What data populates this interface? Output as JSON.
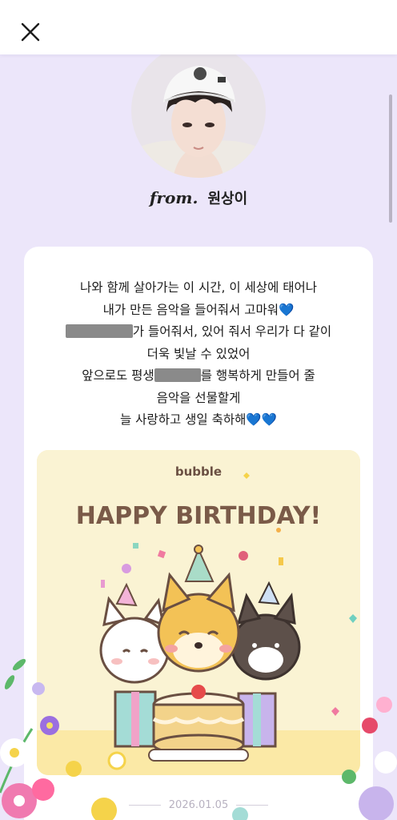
{
  "header": {
    "close_icon": "close-icon"
  },
  "sender": {
    "from_label": "from.",
    "name": "원상이"
  },
  "message": {
    "line1": "나와 함께 살아가는 이 시간, 이 세상에 태어나",
    "line2": "내가 만든 음악을 들어줘서 고마워",
    "line3_suffix": "가 들어줘서, 있어 줘서 우리가 다 같이",
    "line4": "더욱 빛날 수 있었어",
    "line5_prefix": "앞으로도 평생",
    "line5_suffix": "를 행복하게 만들어 줄",
    "line6": "음악을 선물할게",
    "line7": "늘 사랑하고 생일 축하해",
    "heart_glyph": "💙"
  },
  "birthday_card": {
    "brand": "bubble",
    "headline": "HAPPY BIRTHDAY!",
    "colors": {
      "background": "#faf3d3",
      "headline": "#7a5a48",
      "floor": "#fbe9a6"
    }
  },
  "footer": {
    "date": "2026.01.05"
  },
  "colors": {
    "page_bg": "#ece6fa",
    "heart": "#2f7bf5"
  }
}
